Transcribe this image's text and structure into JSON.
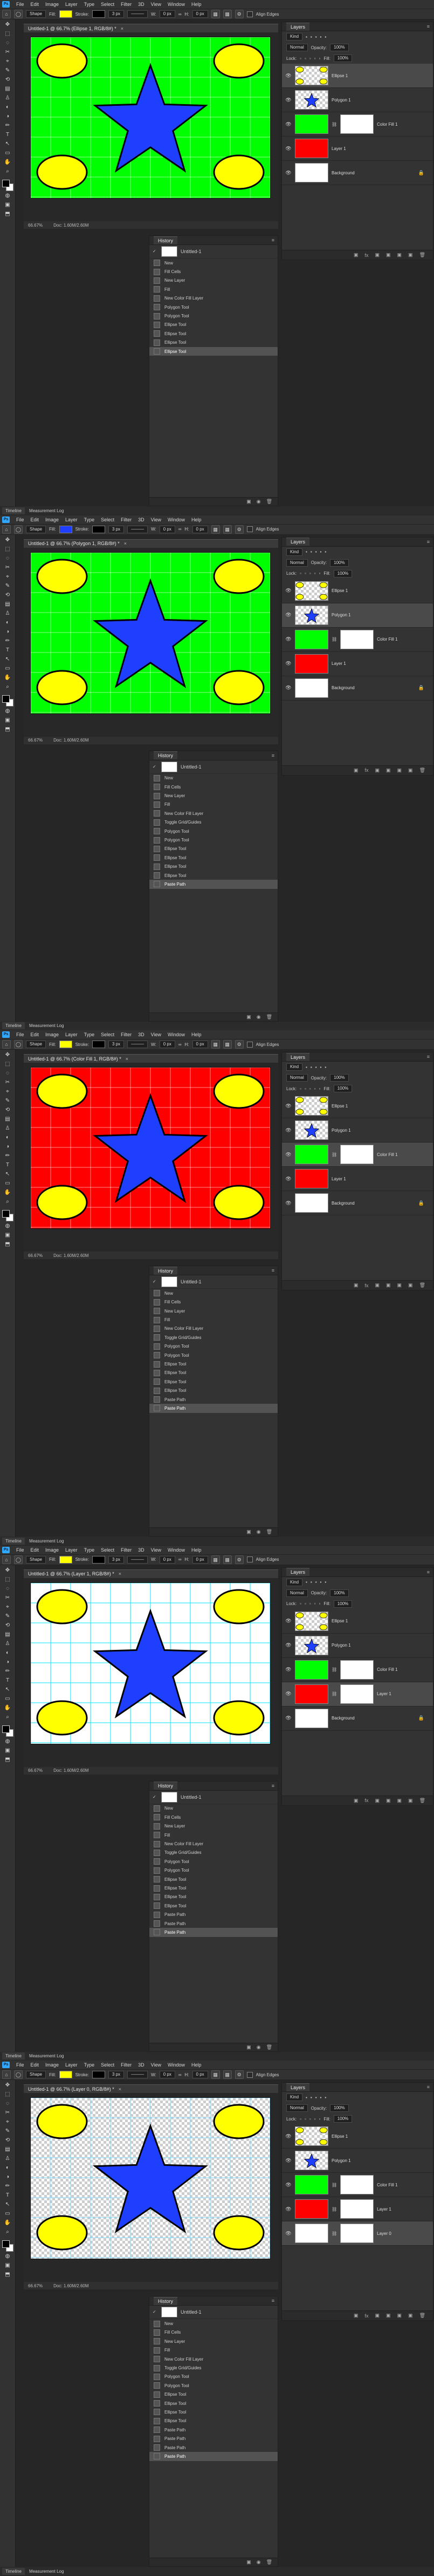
{
  "menu": [
    "File",
    "Edit",
    "Image",
    "Layer",
    "Type",
    "Select",
    "Filter",
    "3D",
    "View",
    "Window",
    "Help"
  ],
  "options": {
    "shape_label": "Shape",
    "fill_label": "Fill:",
    "stroke_label": "Stroke:",
    "stroke_width": "3 px",
    "w_label": "W:",
    "w_value": "0 px",
    "h_label": "H:",
    "h_value": "0 px",
    "align_edges": "Align Edges",
    "stroke_swatch_text": "NNN"
  },
  "taskbar": {
    "tab1": "Timeline",
    "tab2": "Measurement Log"
  },
  "history_panel": {
    "title": "History",
    "snapshot": "Untitled-1"
  },
  "layers_panel": {
    "title": "Layers",
    "kind": "Kind",
    "blend": "Normal",
    "opacity_label": "Opacity:",
    "opacity": "100%",
    "lock_label": "Lock:",
    "fill_label": "Fill:",
    "fill": "100%"
  },
  "colors": {
    "green": "#00ff00",
    "red": "#ff0000",
    "yellow": "#ffff00",
    "blue": "#1f3fff",
    "grid": "#00e5ff"
  },
  "shots": [
    {
      "title": "Untitled-1 @ 66.7% (Ellipse 1, RGB/8#) *",
      "zoom": "66.67%",
      "doc": "Doc: 1.60M/2.60M",
      "bg": "green",
      "history": [
        "Untitled-1",
        "New",
        "Fill Cells",
        "New Layer",
        "Fill",
        "New Color Fill Layer",
        "Polygon Tool",
        "Polygon Tool",
        "Ellipse Tool",
        "Ellipse Tool",
        "Ellipse Tool",
        "Ellipse Tool"
      ],
      "layers": [
        {
          "name": "Ellipse 1",
          "thumb": "ellipse",
          "sel": true
        },
        {
          "name": "Polygon 1",
          "thumb": "star",
          "sel": false
        },
        {
          "name": "Color Fill 1",
          "thumb": "green",
          "mask": true,
          "sel": false
        },
        {
          "name": "Layer 1",
          "thumb": "red",
          "sel": false
        },
        {
          "name": "Background",
          "thumb": "white",
          "lock": true,
          "sel": false
        }
      ]
    },
    {
      "title": "Untitled-1 @ 66.7% (Polygon 1, RGB/8#) *",
      "zoom": "66.67%",
      "doc": "Doc: 1.60M/2.60M",
      "bg": "green",
      "history": [
        "Untitled-1",
        "New",
        "Fill Cells",
        "New Layer",
        "Fill",
        "New Color Fill Layer",
        "Toggle Grid/Guides",
        "Polygon Tool",
        "Polygon Tool",
        "Ellipse Tool",
        "Ellipse Tool",
        "Ellipse Tool",
        "Ellipse Tool",
        "Paste Path"
      ],
      "layers": [
        {
          "name": "Ellipse 1",
          "thumb": "ellipse",
          "sel": false
        },
        {
          "name": "Polygon 1",
          "thumb": "star",
          "sel": true
        },
        {
          "name": "Color Fill 1",
          "thumb": "green",
          "mask": true,
          "sel": false
        },
        {
          "name": "Layer 1",
          "thumb": "red",
          "sel": false
        },
        {
          "name": "Background",
          "thumb": "white",
          "lock": true,
          "sel": false
        }
      ]
    },
    {
      "title": "Untitled-1 @ 66.7% (Color Fill 1, RGB/8#) *",
      "zoom": "66.67%",
      "doc": "Doc: 1.60M/2.60M",
      "bg": "red",
      "history": [
        "Untitled-1",
        "New",
        "Fill Cells",
        "New Layer",
        "Fill",
        "New Color Fill Layer",
        "Toggle Grid/Guides",
        "Polygon Tool",
        "Polygon Tool",
        "Ellipse Tool",
        "Ellipse Tool",
        "Ellipse Tool",
        "Ellipse Tool",
        "Paste Path",
        "Paste Path"
      ],
      "layers": [
        {
          "name": "Ellipse 1",
          "thumb": "ellipse",
          "sel": false
        },
        {
          "name": "Polygon 1",
          "thumb": "star",
          "sel": false
        },
        {
          "name": "Color Fill 1",
          "thumb": "green",
          "mask": true,
          "sel": true
        },
        {
          "name": "Layer 1",
          "thumb": "red",
          "sel": false
        },
        {
          "name": "Background",
          "thumb": "white",
          "lock": true,
          "sel": false
        }
      ]
    },
    {
      "title": "Untitled-1 @ 66.7% (Layer 1, RGB/8#) *",
      "zoom": "66.67%",
      "doc": "Doc: 1.60M/2.60M",
      "bg": "white",
      "history": [
        "Untitled-1",
        "New",
        "Fill Cells",
        "New Layer",
        "Fill",
        "New Color Fill Layer",
        "Toggle Grid/Guides",
        "Polygon Tool",
        "Polygon Tool",
        "Ellipse Tool",
        "Ellipse Tool",
        "Ellipse Tool",
        "Ellipse Tool",
        "Paste Path",
        "Paste Path",
        "Paste Path"
      ],
      "layers": [
        {
          "name": "Ellipse 1",
          "thumb": "ellipse",
          "sel": false
        },
        {
          "name": "Polygon 1",
          "thumb": "star",
          "sel": false
        },
        {
          "name": "Color Fill 1",
          "thumb": "green",
          "mask": true,
          "sel": false
        },
        {
          "name": "Layer 1",
          "thumb": "red",
          "mask": true,
          "sel": true
        },
        {
          "name": "Background",
          "thumb": "white",
          "lock": true,
          "sel": false
        }
      ]
    },
    {
      "title": "Untitled-1 @ 66.7% (Layer 0, RGB/8#) *",
      "zoom": "66.67%",
      "doc": "Doc: 1.60M/2.60M",
      "bg": "checker",
      "history": [
        "Untitled-1",
        "New",
        "Fill Cells",
        "New Layer",
        "Fill",
        "New Color Fill Layer",
        "Toggle Grid/Guides",
        "Polygon Tool",
        "Polygon Tool",
        "Ellipse Tool",
        "Ellipse Tool",
        "Ellipse Tool",
        "Ellipse Tool",
        "Paste Path",
        "Paste Path",
        "Paste Path",
        "Paste Path"
      ],
      "layers": [
        {
          "name": "Ellipse 1",
          "thumb": "ellipse",
          "sel": false
        },
        {
          "name": "Polygon 1",
          "thumb": "star",
          "sel": false
        },
        {
          "name": "Color Fill 1",
          "thumb": "green",
          "mask": true,
          "sel": false
        },
        {
          "name": "Layer 1",
          "thumb": "red",
          "mask": true,
          "sel": false
        },
        {
          "name": "Layer 0",
          "thumb": "white",
          "mask": true,
          "sel": true
        }
      ]
    }
  ]
}
